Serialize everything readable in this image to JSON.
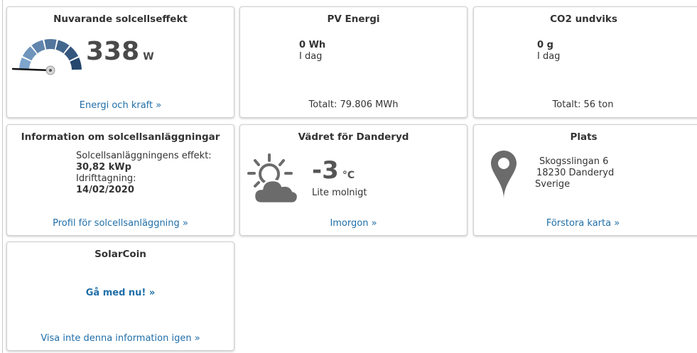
{
  "power": {
    "title": "Nuvarande solcellseffekt",
    "value": "338",
    "unit": "W",
    "link": "Energi och kraft »",
    "gauge_fraction": 0.34
  },
  "pv_energy": {
    "title": "PV Energi",
    "value": "0 Wh",
    "period": "I dag",
    "total": "Totalt: 79.806 MWh"
  },
  "co2": {
    "title": "CO2 undviks",
    "value": "0 g",
    "period": "I dag",
    "total": "Totalt: 56 ton"
  },
  "plant_info": {
    "title": "Information om solcellsanläggningar",
    "power_label": "Solcellsanläggningens effekt:",
    "power_value": "30,82 kWp",
    "commission_label": "Idrifttagning:",
    "commission_date": "14/02/2020",
    "link": "Profil för solcellsanläggning »"
  },
  "weather": {
    "title": "Vädret för Danderyd",
    "temperature": "-3",
    "unit": "°C",
    "description": "Lite molnigt",
    "link": "Imorgon »",
    "icon": "partly-cloudy-icon"
  },
  "location": {
    "title": "Plats",
    "street": "Skogsslingan 6",
    "city": "18230 Danderyd",
    "country": "Sverige",
    "link": "Förstora karta »",
    "icon": "map-pin-icon"
  },
  "solarcoin": {
    "title": "SolarCoin",
    "cta": "Gå med nu! »",
    "dismiss": "Visa inte denna information igen »"
  },
  "colors": {
    "link": "#1f6ea8",
    "gauge_dark": "#26476e",
    "gauge_light": "#7ea4cc",
    "icon_gray": "#6b6b6b"
  }
}
